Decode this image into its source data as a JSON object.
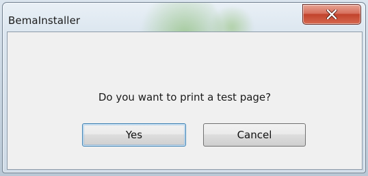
{
  "window": {
    "title": "BemaInstaller"
  },
  "dialog": {
    "message": "Do you want to print a test page?",
    "buttons": {
      "yes_label": "Yes",
      "cancel_label": "Cancel"
    }
  },
  "colors": {
    "close_button": "#c1432c",
    "focus_border": "#3c7fb1"
  },
  "icons": {
    "close": "close-icon"
  }
}
